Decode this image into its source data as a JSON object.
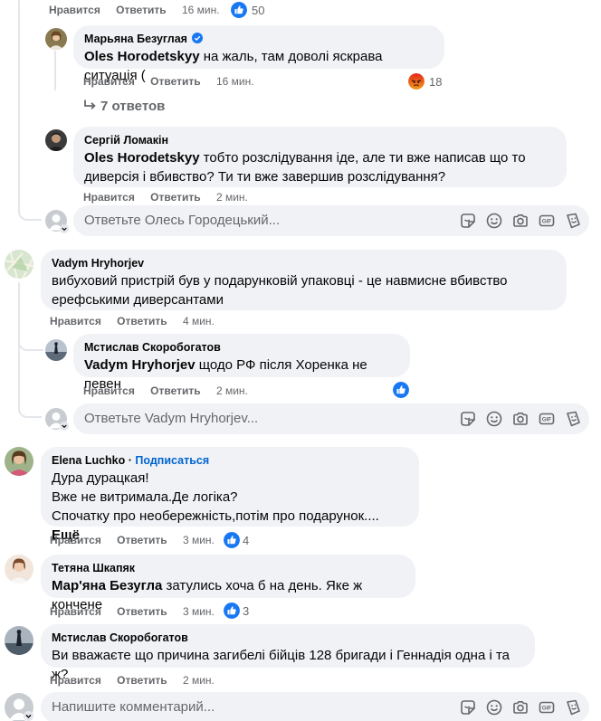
{
  "actions": {
    "like": "Нравится",
    "reply": "Ответить"
  },
  "top_row": {
    "time": "16 мин.",
    "reaction_count": "50"
  },
  "thread1": {
    "c1": {
      "author": "Марьяна Безуглая",
      "mention": "Oles Horodetskyy",
      "text": "на жаль, там доволі яскрава ситуація (",
      "time": "16 мин.",
      "reaction_count": "18"
    },
    "replies_link": "7 ответов",
    "c2": {
      "author": "Сергій Ломакін",
      "mention": "Oles Horodetskyy",
      "text": "тобто розслідування іде, але ти вже написав що то диверсія і вбивство? Ти ти вже завершив розслідування?",
      "time": "2 мин."
    },
    "reply_placeholder": "Ответьте Олесь Городецький..."
  },
  "thread2": {
    "c1": {
      "author": "Vadym Hryhorjev",
      "text": "вибуховий пристрій був у подарунковій упаковці - це навмисне вбивство ерефськими диверсантами",
      "time": "4 мин."
    },
    "c2": {
      "author": "Мстислав Скоробогатов",
      "mention": "Vadym Hryhorjev",
      "text": "щодо РФ після Хоренка не певен",
      "time": "2 мин."
    },
    "reply_placeholder": "Ответьте Vadym Hryhorjev..."
  },
  "c_elena": {
    "author": "Elena Luchko",
    "follow": "Подписаться",
    "line1": "Дура дурацкая!",
    "line2": "Вже не витримала.Де логіка?",
    "line3": "Спочатку про необережність,потім про подарунок....",
    "more": "Ещё",
    "time": "3 мин.",
    "reaction_count": "4"
  },
  "c_tetiana": {
    "author": "Тетяна Шкапяк",
    "mention": "Мар'яна Безугла",
    "text": "затулись хоча б на день. Яке ж кончене",
    "time": "3 мин.",
    "reaction_count": "3"
  },
  "c_mstyslav": {
    "author": "Мстислав Скоробогатов",
    "text": "Ви вважаєте що причина загибелі бійців 128 бригади і Геннадія одна і та ж?",
    "time": "2 мин."
  },
  "main_input": {
    "placeholder": "Напишите комментарий..."
  },
  "icons": [
    "like-reaction-icon",
    "angry-reaction-icon",
    "verified-badge-icon",
    "reply-arrow-icon",
    "sticker-icon",
    "emoji-icon",
    "camera-icon",
    "gif-icon",
    "avatar-sticker-icon"
  ],
  "colors": {
    "bubble": "#f0f2f5",
    "secondary_text": "#65676b",
    "link_blue": "#0064d1",
    "like_blue": "#1877f2",
    "angry": "#e9710f"
  }
}
